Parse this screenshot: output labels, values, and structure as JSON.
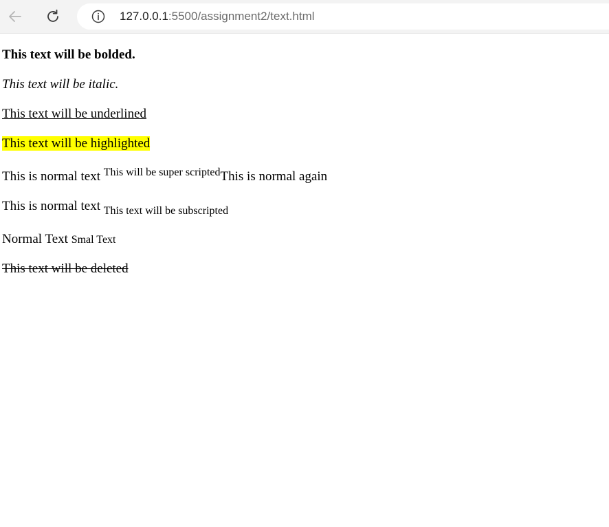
{
  "browser": {
    "url_host": "127.0.0.1",
    "url_rest": ":5500/assignment2/text.html",
    "icons": {
      "back": "arrow-left-icon",
      "reload": "reload-icon",
      "info": "info-icon"
    }
  },
  "page": {
    "bold_text": "This text will be bolded.",
    "italic_text": "This text will be italic.",
    "underlined_text": "This text will be underlined",
    "highlighted_text": "This text will be highlighted",
    "highlight_color": "#ffff00",
    "superscript_line": {
      "before": "This is normal text ",
      "sup": "This will be super scripted",
      "after": "This is normal again"
    },
    "subscript_line": {
      "before": "This is normal text ",
      "sub": "This text will be subscripted"
    },
    "small_line": {
      "normal": "Normal Text ",
      "small": "Smal Text"
    },
    "deleted_text": "This text will be deleted"
  }
}
